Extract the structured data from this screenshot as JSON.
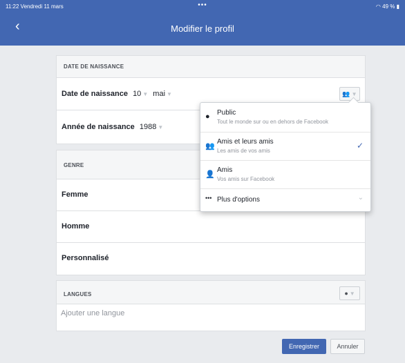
{
  "status": {
    "time": "11:22",
    "date": "Vendredi 11 mars",
    "dots": "•••",
    "right": "49 %"
  },
  "nav": {
    "back": "<",
    "title": "Modifier le profil"
  },
  "birth": {
    "section": "DATE DE NAISSANCE",
    "date_label": "Date de naissance",
    "day": "10",
    "month": "mai",
    "year_label": "Année de naissance",
    "year": "1988"
  },
  "gender": {
    "section": "GENRE",
    "options": [
      "Femme",
      "Homme",
      "Personnalisé"
    ]
  },
  "languages": {
    "section": "LANGUES",
    "placeholder": "Ajouter une langue"
  },
  "buttons": {
    "save": "Enregistrer",
    "cancel": "Annuler"
  },
  "privacy_menu": {
    "options": [
      {
        "title": "Public",
        "subtitle": "Tout le monde sur ou en dehors de Facebook",
        "icon": "globe-icon"
      },
      {
        "title": "Amis et leurs amis",
        "subtitle": "Les amis de vos amis",
        "icon": "friends-of-friends-icon",
        "selected": true
      },
      {
        "title": "Amis",
        "subtitle": "Vos amis sur Facebook",
        "icon": "friends-icon"
      },
      {
        "title": "Plus d'options",
        "icon": "more-icon"
      }
    ]
  },
  "colors": {
    "brand": "#4267b2",
    "background": "#e9ebee"
  }
}
